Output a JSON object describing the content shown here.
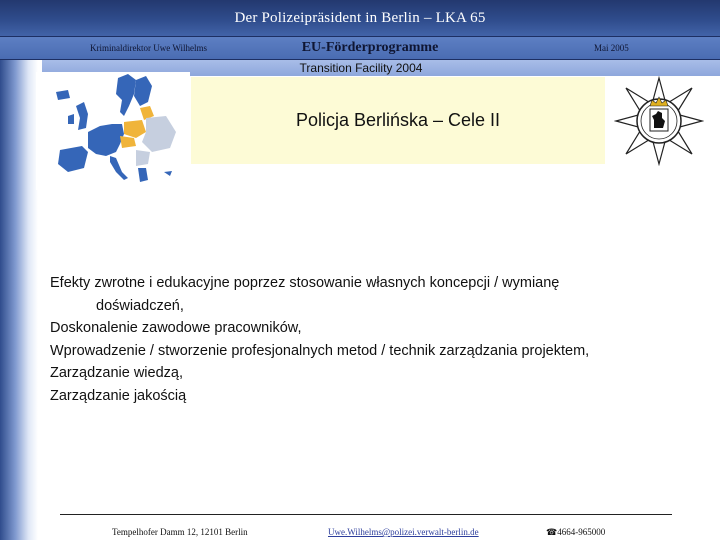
{
  "header": {
    "title": "Der Polizeipräsident in Berlin – LKA 65",
    "author": "Kriminaldirektor Uwe Wilhelms",
    "program": "EU-Förderprogramme",
    "date": "Mai 2005"
  },
  "subtitle": "Transition Facility 2004",
  "slide_title": "Policja Berlińska – Cele II",
  "body": {
    "line1": "Efekty zwrotne i edukacyjne poprzez stosowanie własnych koncepcji / wymianę",
    "line1_cont": "doświadczeń,",
    "line2": "Doskonalenie zawodowe pracowników,",
    "line3": "Wprowadzenie / stworzenie profesjonalnych metod / technik zarządzania projektem,",
    "line4": "Zarządzanie wiedzą,",
    "line5": "Zarządzanie jakością"
  },
  "footer": {
    "address": "Tempelhofer Damm 12, 12101 Berlin",
    "email": "Uwe.Wilhelms@polizei.verwalt-berlin.de",
    "phone_icon": "telephone-icon",
    "phone_glyph": "☎",
    "phone": "4664-965000"
  },
  "colors": {
    "header_dark": "#23386f",
    "header_mid": "#4a6cb2",
    "map_eu": "#3566b8",
    "map_new_members": "#f0b43a",
    "title_box": "#fdfbd6"
  }
}
